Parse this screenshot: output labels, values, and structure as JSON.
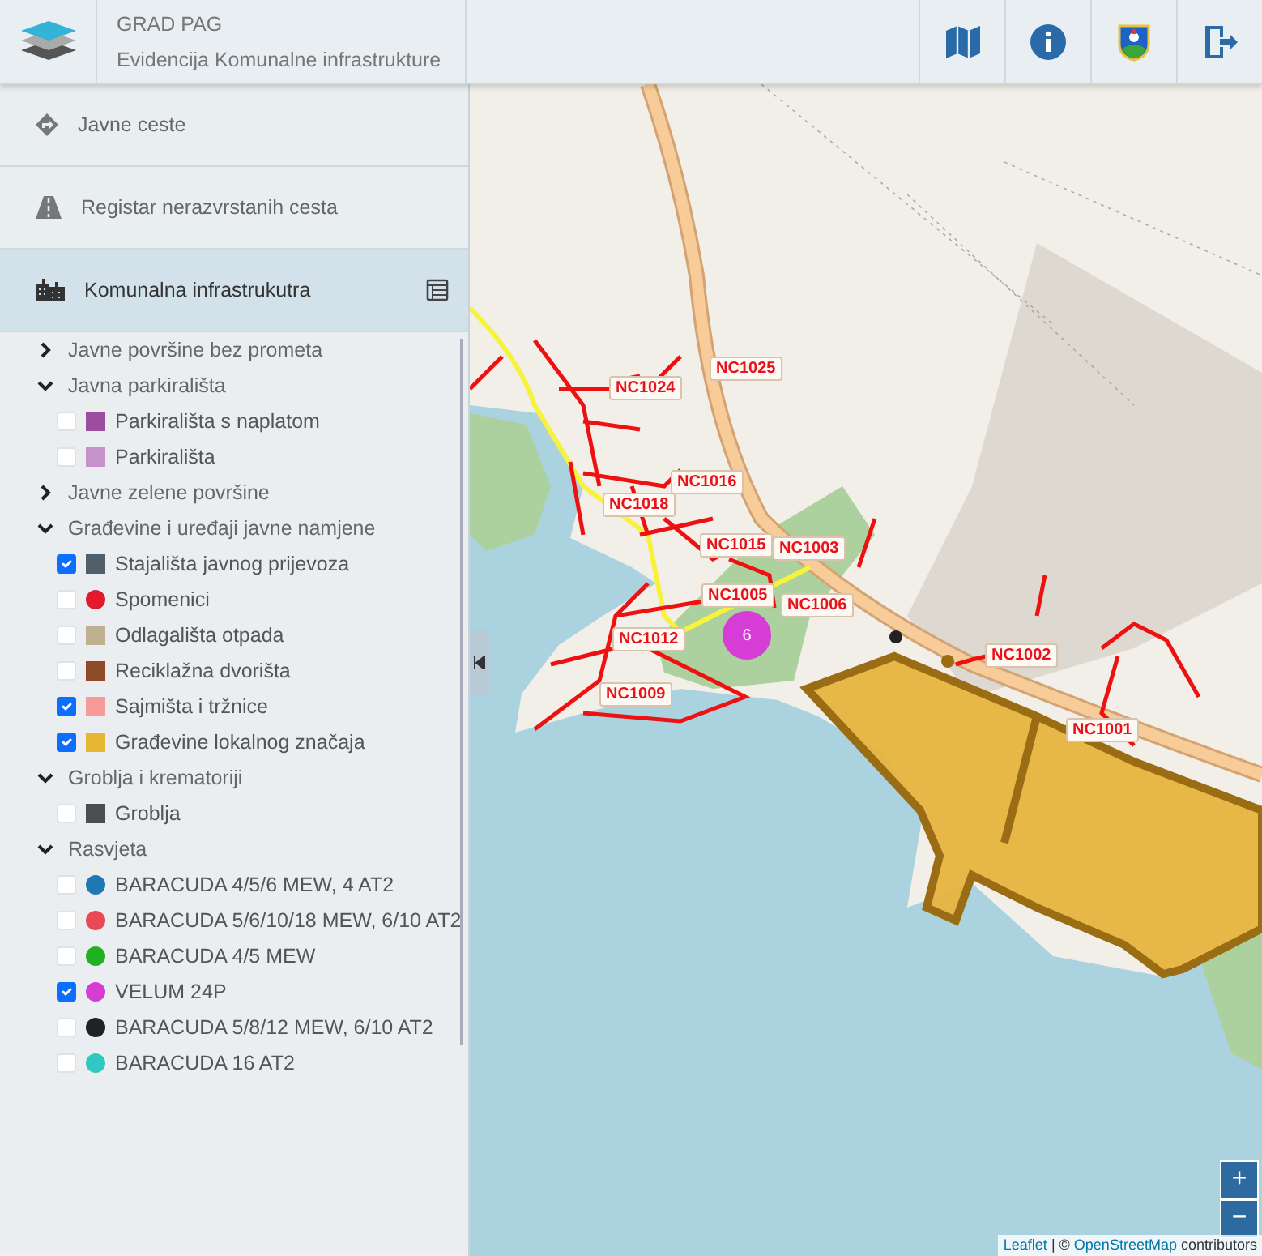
{
  "header": {
    "title": "GRAD PAG",
    "subtitle": "Evidencija Komunalne infrastrukture"
  },
  "nav": [
    {
      "label": "Javne ceste",
      "selected": false
    },
    {
      "label": "Registar nerazvrstanih cesta",
      "selected": false
    },
    {
      "label": "Komunalna infrastrukutra",
      "selected": true
    }
  ],
  "layers": [
    {
      "label": "Javne površine bez prometa",
      "expanded": false
    },
    {
      "label": "Javna parkirališta",
      "expanded": true,
      "children": [
        {
          "label": "Parkirališta s naplatom",
          "checked": false,
          "color": "#9b4ea0",
          "kind": "square"
        },
        {
          "label": "Parkirališta",
          "checked": false,
          "color": "#c792c7",
          "kind": "square"
        }
      ]
    },
    {
      "label": "Javne zelene površine",
      "expanded": false
    },
    {
      "label": "Građevine i uređaji javne namjene",
      "expanded": true,
      "children": [
        {
          "label": "Stajališta javnog prijevoza",
          "checked": true,
          "color": "#4f5f6b",
          "kind": "square"
        },
        {
          "label": "Spomenici",
          "checked": false,
          "color": "#e31a2b",
          "kind": "dot"
        },
        {
          "label": "Odlagališta otpada",
          "checked": false,
          "color": "#bfb08f",
          "kind": "square"
        },
        {
          "label": "Reciklažna dvorišta",
          "checked": false,
          "color": "#8e4a25",
          "kind": "square"
        },
        {
          "label": "Sajmišta i tržnice",
          "checked": true,
          "color": "#f79a9a",
          "kind": "square"
        },
        {
          "label": "Građevine lokalnog značaja",
          "checked": true,
          "color": "#e8b630",
          "kind": "square"
        }
      ]
    },
    {
      "label": "Groblja i krematoriji",
      "expanded": true,
      "children": [
        {
          "label": "Groblja",
          "checked": false,
          "color": "#4d4d4d",
          "kind": "square"
        }
      ]
    },
    {
      "label": "Rasvjeta",
      "expanded": true,
      "children": [
        {
          "label": "BARACUDA 4/5/6 MEW, 4 AT2",
          "checked": false,
          "color": "#1f77b4",
          "kind": "dot"
        },
        {
          "label": "BARACUDA 5/6/10/18 MEW, 6/10 AT2",
          "checked": false,
          "color": "#e84a55",
          "kind": "dot"
        },
        {
          "label": "BARACUDA 4/5 MEW",
          "checked": false,
          "color": "#22b022",
          "kind": "dot"
        },
        {
          "label": "VELUM 24P",
          "checked": true,
          "color": "#d63cd6",
          "kind": "dot"
        },
        {
          "label": "BARACUDA 5/8/12 MEW, 6/10 AT2",
          "checked": false,
          "color": "#222222",
          "kind": "dot"
        },
        {
          "label": "BARACUDA 16 AT2",
          "checked": false,
          "color": "#30c8c0",
          "kind": "dot"
        }
      ]
    }
  ],
  "map": {
    "markers": [
      {
        "label": "NC1024"
      },
      {
        "label": "NC1025"
      },
      {
        "label": "NC1016"
      },
      {
        "label": "NC1018"
      },
      {
        "label": "NC1015"
      },
      {
        "label": "NC1003"
      },
      {
        "label": "NC1005"
      },
      {
        "label": "NC1006"
      },
      {
        "label": "NC1012"
      },
      {
        "label": "NC1009"
      },
      {
        "label": "NC1002"
      },
      {
        "label": "NC1001"
      }
    ],
    "cluster": {
      "count": "6"
    },
    "zoom_in": "+",
    "zoom_out": "−",
    "attribution": {
      "link_1": "Leaflet",
      "middle": " | © ",
      "link_2": "OpenStreetMap",
      "end": " contributors"
    }
  }
}
